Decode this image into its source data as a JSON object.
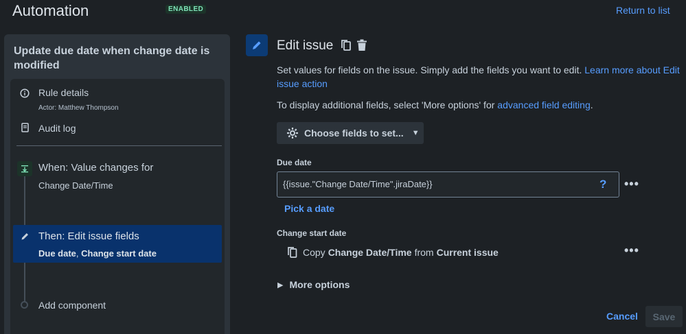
{
  "header": {
    "title": "Automation",
    "status_badge": "ENABLED",
    "return_link": "Return to list"
  },
  "sidebar": {
    "rule_title": "Update due date when change date is modified",
    "rule_details": {
      "label": "Rule details",
      "actor": "Actor: Matthew Thompson",
      "icon": "info-icon"
    },
    "audit_log": {
      "label": "Audit log",
      "icon": "document-icon"
    },
    "trigger": {
      "title": "When: Value changes for",
      "subtitle": "Change Date/Time",
      "icon": "trigger-icon"
    },
    "action": {
      "title": "Then: Edit issue fields",
      "field1": "Due date",
      "separator": ", ",
      "field2": "Change start date",
      "icon": "pencil-icon"
    },
    "add_component": "Add component"
  },
  "panel": {
    "title": "Edit issue",
    "description_text": "Set values for fields on the issue. Simply add the fields you want to edit. ",
    "description_link": "Learn more about Edit issue action",
    "extra_text": "To display additional fields, select 'More options' for ",
    "extra_link": "advanced field editing",
    "extra_end": ".",
    "choose_button": "Choose fields to set...",
    "due_date": {
      "label": "Due date",
      "value": "{{issue.\"Change Date/Time\".jiraDate}}",
      "help": "?",
      "pick_date": "Pick a date"
    },
    "change_start_date": {
      "label": "Change start date",
      "copy_word": "Copy",
      "copy_field": "Change Date/Time",
      "from_word": "from",
      "from_source": "Current issue"
    },
    "more_options": "More options",
    "more_dots": "•••",
    "cancel": "Cancel",
    "save": "Save"
  },
  "colors": {
    "background": "#1d2125",
    "panel": "#2c333a",
    "link": "#579dff",
    "selected": "#09326c",
    "enabled_badge": "#7ee2b8"
  }
}
